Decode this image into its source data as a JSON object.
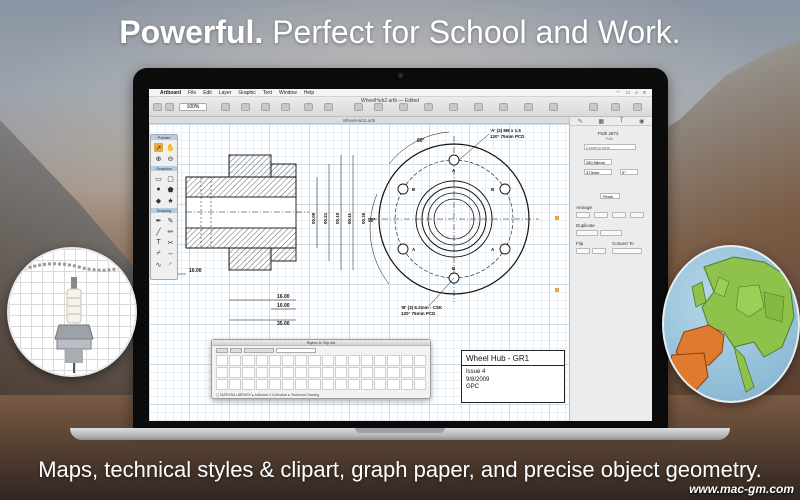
{
  "headline": {
    "bold": "Powerful.",
    "rest": " Perfect for School and Work."
  },
  "footer": {
    "caption": "Maps, technical styles & clipart, graph paper, and precise object geometry."
  },
  "watermark": "www.mac-gm.com",
  "app": {
    "menubar": [
      "Artboard",
      "File",
      "Edit",
      "Layer",
      "Graphic",
      "Text",
      "Window",
      "Help"
    ],
    "window_title": "WheelHub2.artb — Edited",
    "doc_tab": "WheelHub2.artb",
    "zoom": "100%",
    "palette_sections": [
      "Graphics",
      "Drawing",
      "Pointer"
    ]
  },
  "drawing": {
    "callout_top": [
      "'A' (3) M8 x 1.5",
      "120° 75mm PCD"
    ],
    "callout_bottom": [
      "'B' (3) 6.2mm - CSK",
      "120° 75mm PCD"
    ],
    "labels_A": "A",
    "labels_B": "B",
    "angle_top": "60°",
    "angle_left": "90°",
    "dim_left": "10.00",
    "dim_bottom": [
      "16.00",
      "10.00",
      "35.00"
    ],
    "dim_vertical": [
      "00.00",
      "00.21",
      "00.10",
      "00.11",
      "00.10",
      "00.35"
    ],
    "shaft_dims": [
      "00.60",
      "00.55"
    ]
  },
  "title_block": {
    "title": "Wheel Hub - GR1",
    "issue": "Issue 4",
    "date": "9/8/2009",
    "author": "GPC"
  },
  "library": {
    "title": "Styles & Clip Art",
    "status": "▢ MATISSA LIBRARY  ▸ Artboard 4 Collection  ▸ Technical Drawing"
  },
  "inspector": {
    "object_name": "Path 2872",
    "object_kind": "Path",
    "drawing_style": "Drawing style",
    "x_value": "280.98mm",
    "y_value": "373mm",
    "w_value": "79mm",
    "rot_value": "0°",
    "arrange_label": "Arrange",
    "duplicate_label": "Duplicate",
    "flip_label": "Flip",
    "convert_label": "Convert To"
  },
  "colors": {
    "accent_orange": "#e8a83a",
    "grid_line": "#c9dcec",
    "spain_france": "#e07a2e",
    "europe_green": "#8fc24a"
  }
}
